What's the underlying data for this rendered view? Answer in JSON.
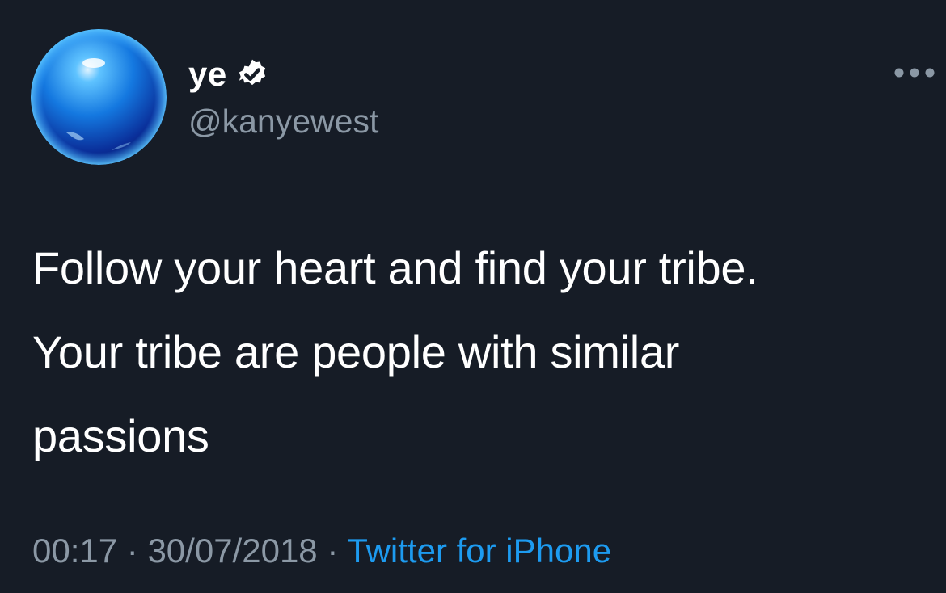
{
  "tweet": {
    "author": {
      "display_name": "ye",
      "handle": "@kanyewest",
      "verified": true
    },
    "text": "Follow your heart and find your tribe.\nYour tribe are people with similar\npassions",
    "time": "00:17",
    "separator": "·",
    "date": "30/07/2018",
    "source": "Twitter for iPhone"
  },
  "icons": {
    "verified": "verified-badge-icon",
    "more": "more-horizontal-icon"
  },
  "colors": {
    "background": "#161c26",
    "text": "#ffffff",
    "secondary": "#8b98a5",
    "link": "#1d9bf0"
  }
}
